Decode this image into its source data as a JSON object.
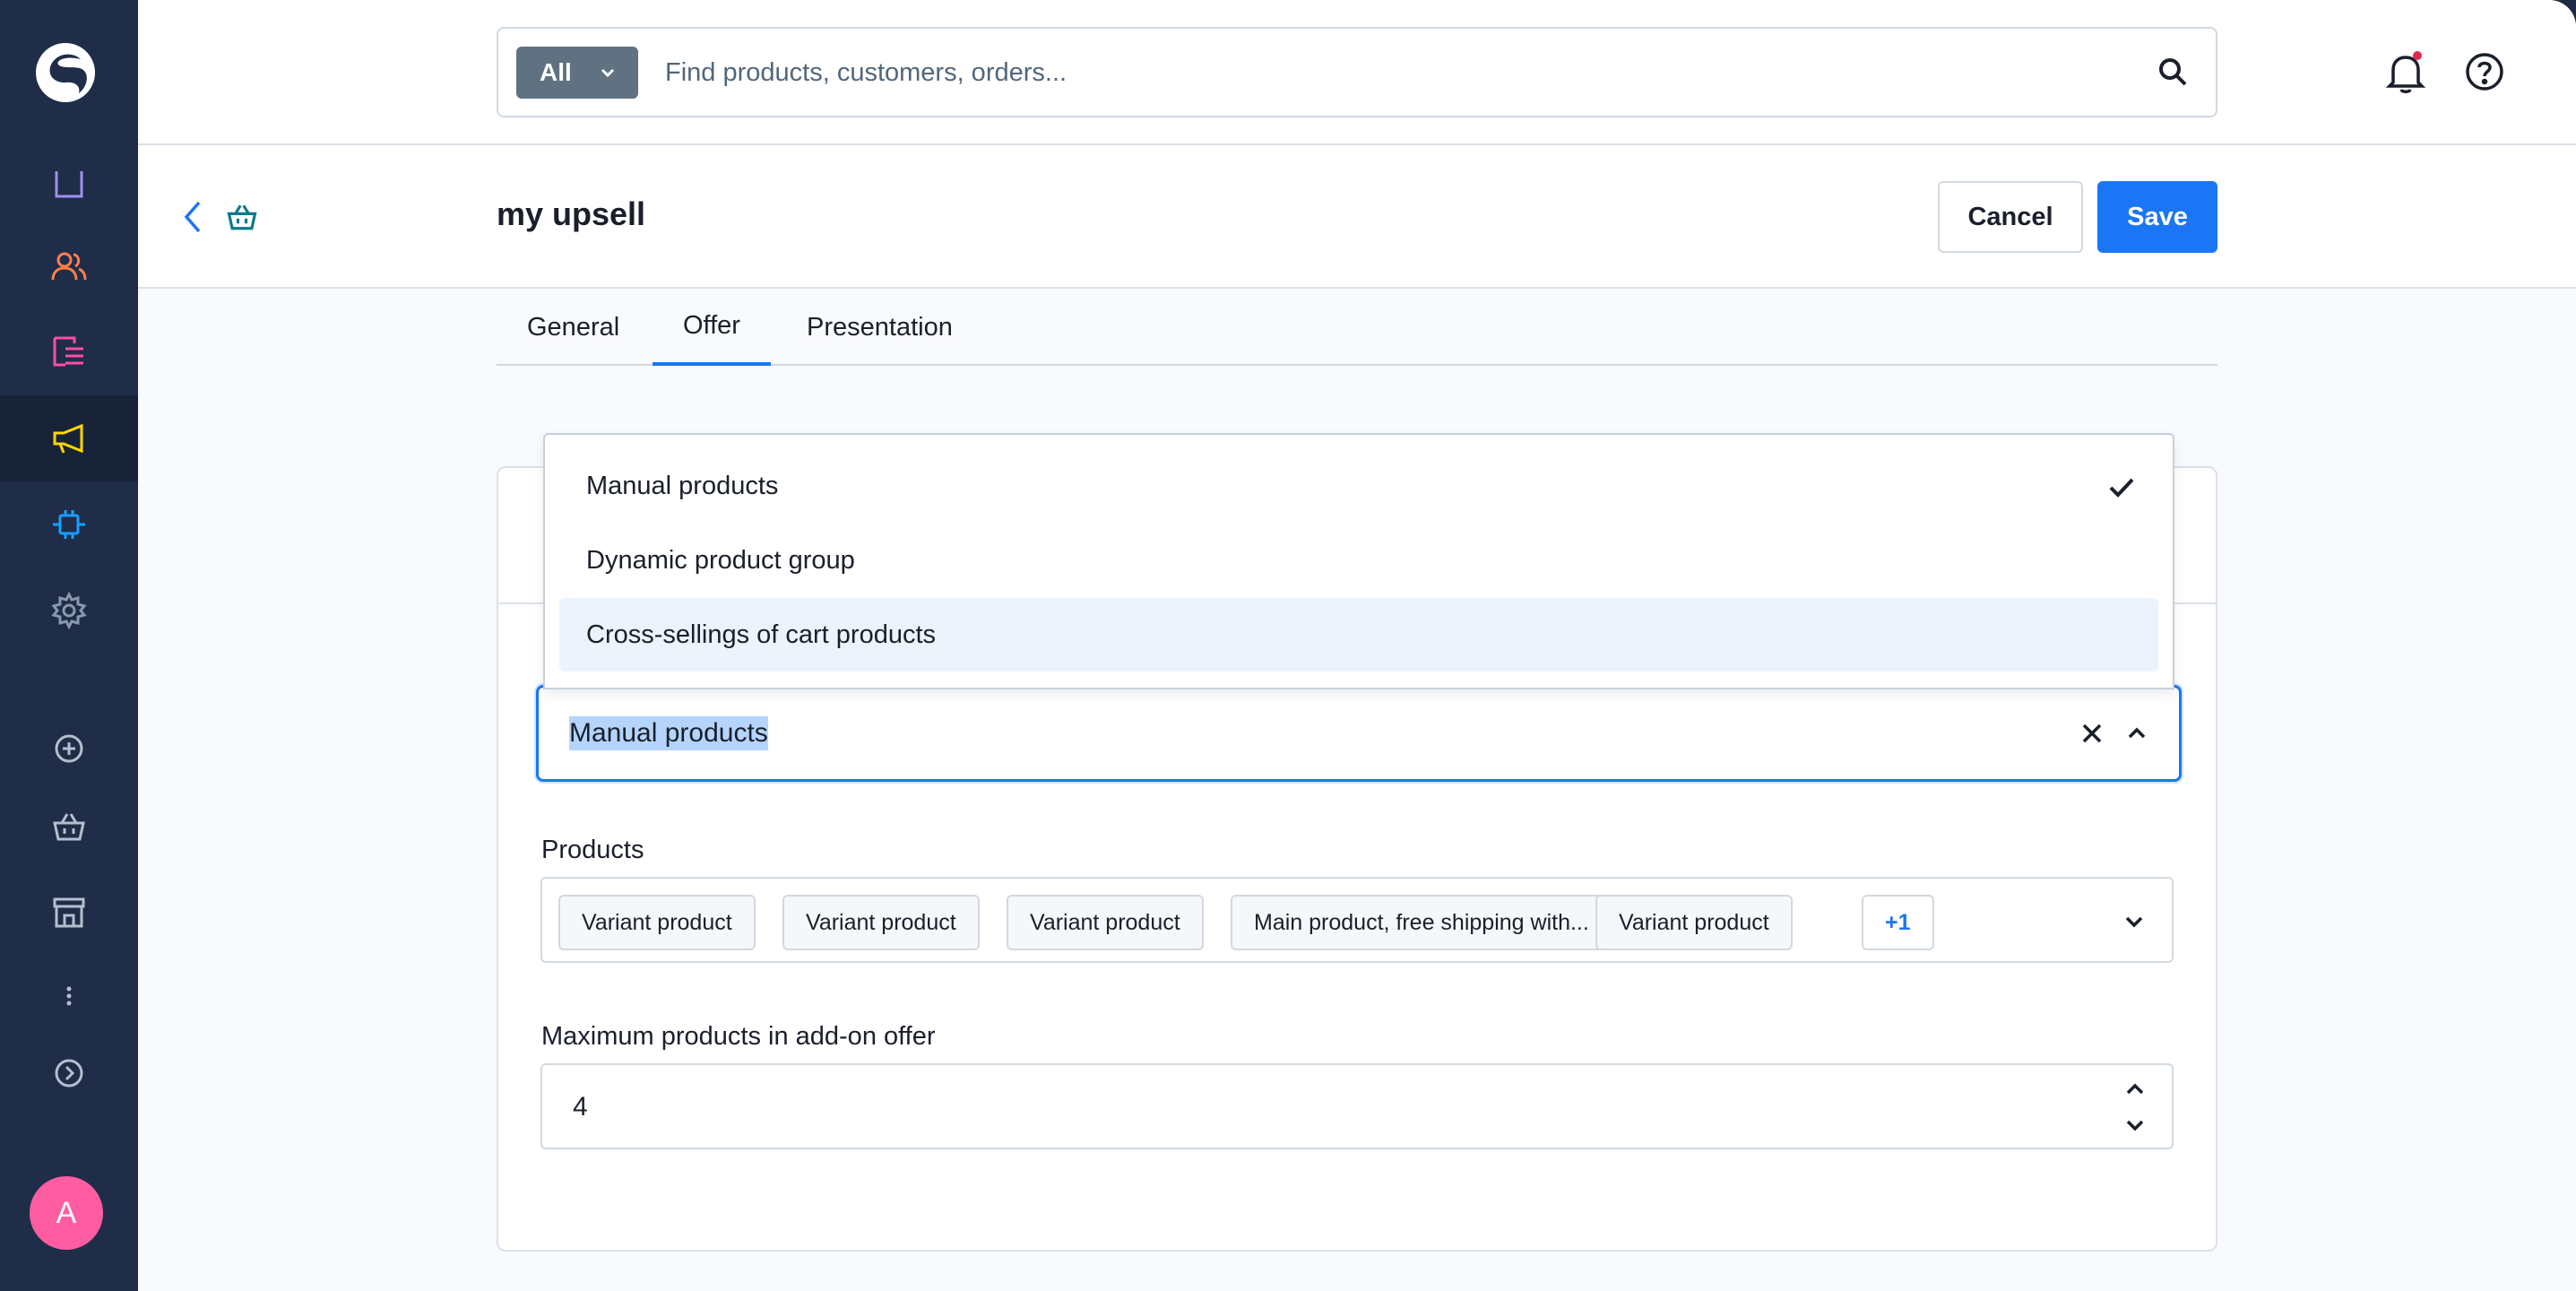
{
  "sidebar": {
    "items": [
      {
        "name": "catalogue-icon",
        "color": "#a28fef"
      },
      {
        "name": "customers-icon",
        "color": "#ff7e4c"
      },
      {
        "name": "orders-icon",
        "color": "#ff4da9"
      },
      {
        "name": "marketing-icon",
        "color": "#ffd700"
      },
      {
        "name": "extensions-icon",
        "color": "#189eff"
      },
      {
        "name": "settings-icon",
        "color": "#8a98ad"
      },
      {
        "name": "add-icon",
        "color": "#b3bfcf"
      },
      {
        "name": "sales-channel-basket-icon",
        "color": "#b3bfcf"
      },
      {
        "name": "storefront-icon",
        "color": "#b3bfcf"
      },
      {
        "name": "more-icon",
        "color": "#b3bfcf"
      },
      {
        "name": "expand-icon",
        "color": "#b3bfcf"
      }
    ],
    "avatar_initial": "A",
    "avatar_color": "#ff5da2"
  },
  "search": {
    "scope_label": "All",
    "placeholder": "Find products, customers, orders..."
  },
  "header": {
    "title": "my upsell",
    "cancel_label": "Cancel",
    "save_label": "Save"
  },
  "tabs": [
    {
      "label": "General",
      "active": false
    },
    {
      "label": "Offer",
      "active": true
    },
    {
      "label": "Presentation",
      "active": false
    }
  ],
  "offer_type": {
    "selected": "Manual products",
    "options": [
      {
        "label": "Manual products",
        "checked": true
      },
      {
        "label": "Dynamic product group",
        "checked": false
      },
      {
        "label": "Cross-sellings of cart products",
        "checked": false,
        "hovered": true
      }
    ]
  },
  "products": {
    "label": "Products",
    "chips": [
      "Variant product",
      "Variant product",
      "Variant product",
      "Main product, free shipping with...",
      "Variant product"
    ],
    "more_label": "+1"
  },
  "max_products": {
    "label": "Maximum products in add-on offer",
    "value": "4"
  },
  "colors": {
    "accent": "#1b76f5",
    "sidebar_bg": "#1f2d48",
    "notification_dot": "#de294c"
  }
}
